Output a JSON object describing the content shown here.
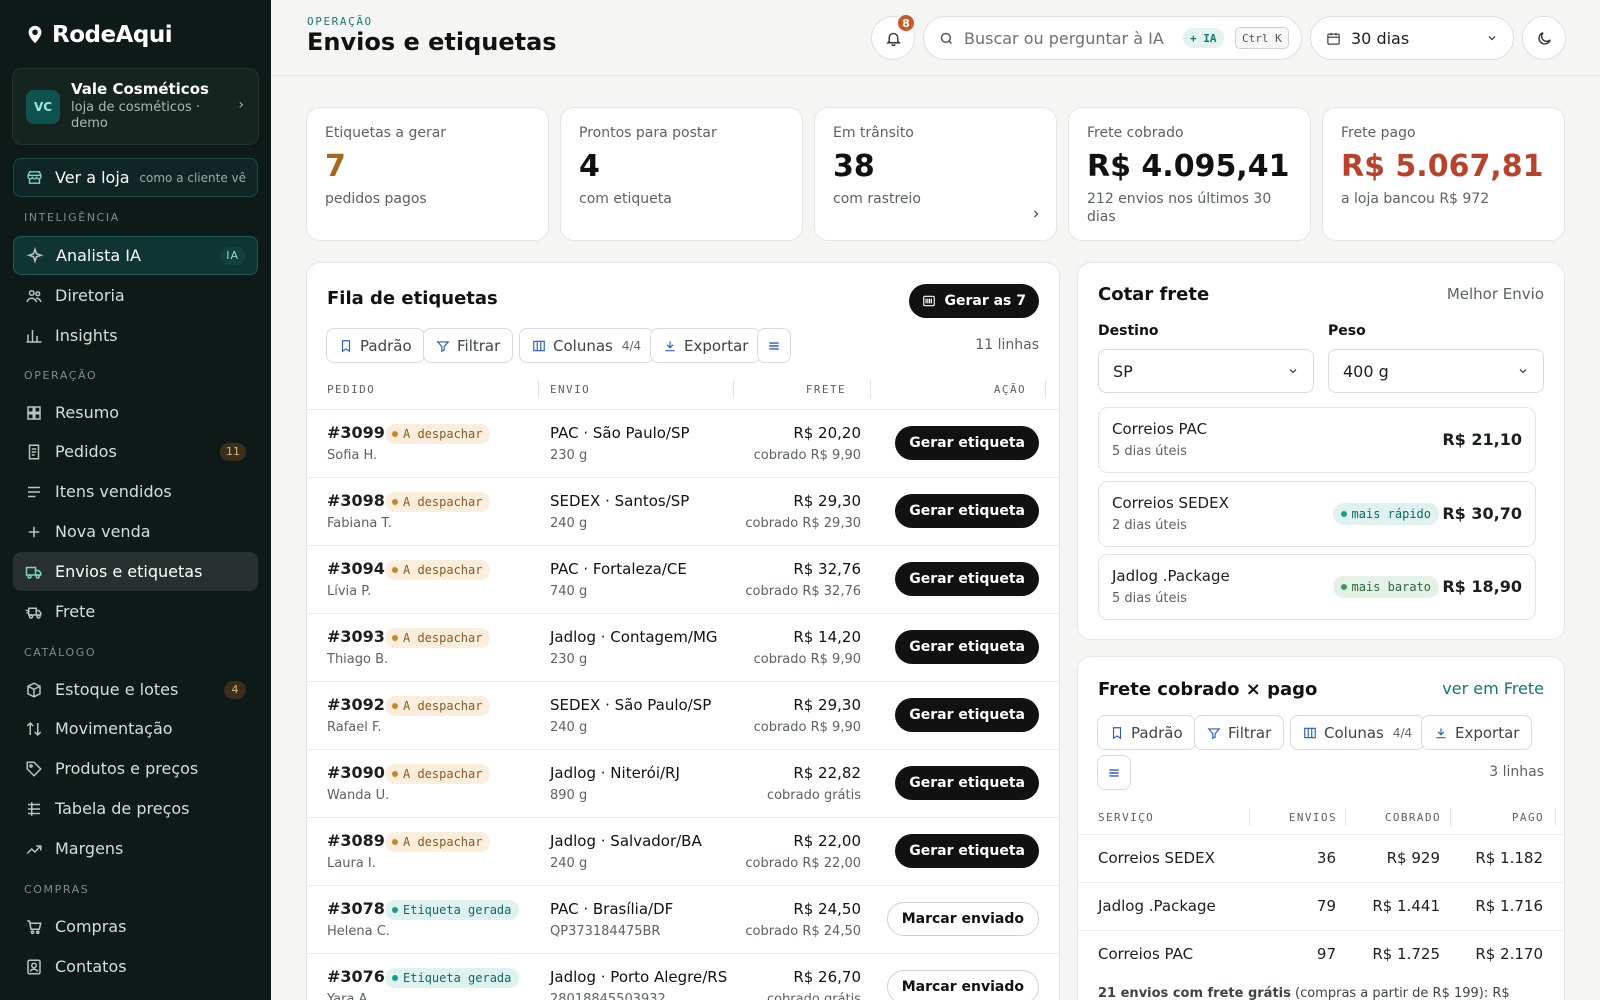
{
  "brand": {
    "name": "RodeAqui"
  },
  "store": {
    "initials": "VC",
    "name": "Vale Cosméticos",
    "subtitle": "loja de cosméticos · demo"
  },
  "view_store": {
    "label": "Ver a loja",
    "hint": "como a cliente vê"
  },
  "sidebar": {
    "sections": {
      "intel": "INTELIGÊNCIA",
      "op": "OPERAÇÃO",
      "cat": "CATÁLOGO",
      "compras": "COMPRAS"
    },
    "items": [
      {
        "label": "Analista IA",
        "badge": "IA",
        "icon": "sparkle-icon"
      },
      {
        "label": "Diretoria",
        "icon": "users-icon"
      },
      {
        "label": "Insights",
        "icon": "bar-chart-icon"
      },
      {
        "label": "Resumo",
        "icon": "grid-icon"
      },
      {
        "label": "Pedidos",
        "badge": "11",
        "icon": "receipt-icon"
      },
      {
        "label": "Itens vendidos",
        "icon": "list-icon"
      },
      {
        "label": "Nova venda",
        "icon": "plus-icon"
      },
      {
        "label": "Envios e etiquetas",
        "icon": "truck-icon"
      },
      {
        "label": "Frete",
        "icon": "truck-fast-icon"
      },
      {
        "label": "Estoque e lotes",
        "badge": "4",
        "icon": "box-icon"
      },
      {
        "label": "Movimentação",
        "icon": "arrows-updown-icon"
      },
      {
        "label": "Produtos e preços",
        "icon": "tag-icon"
      },
      {
        "label": "Tabela de preços",
        "icon": "table-icon"
      },
      {
        "label": "Margens",
        "icon": "trend-icon"
      },
      {
        "label": "Compras",
        "icon": "cart-icon"
      },
      {
        "label": "Contatos",
        "icon": "contact-icon"
      }
    ]
  },
  "header": {
    "eyebrow": "OPERAÇÃO",
    "title": "Envios e etiquetas",
    "notifications": "8",
    "search_placeholder": "Buscar ou perguntar à IA",
    "search_ai_tag": "+ IA",
    "search_shortcut": "Ctrl K",
    "period": "30 dias"
  },
  "kpis": [
    {
      "label": "Etiquetas a gerar",
      "value": "7",
      "sub": "pedidos pagos",
      "color": "#a86a1a"
    },
    {
      "label": "Prontos para postar",
      "value": "4",
      "sub": "com etiqueta",
      "color": "#111111"
    },
    {
      "label": "Em trânsito",
      "value": "38",
      "sub": "com rastreio",
      "color": "#111111"
    },
    {
      "label": "Frete cobrado",
      "value": "R$ 4.095,41",
      "sub": "212 envios nos últimos 30 dias",
      "color": "#111111"
    },
    {
      "label": "Frete pago",
      "value": "R$ 5.067,81",
      "sub": "a loja bancou R$ 972",
      "color": "#b8432a"
    }
  ],
  "queue": {
    "title": "Fila de etiquetas",
    "generate_all": "Gerar as 7",
    "toolbar": {
      "preset": "Padrão",
      "filter": "Filtrar",
      "columns": "Colunas",
      "columns_count": "4/4",
      "export": "Exportar"
    },
    "row_count": "11 linhas",
    "headers": {
      "order": "PEDIDO",
      "shipping": "ENVIO",
      "freight": "FRETE",
      "action": "AÇÃO"
    },
    "rows": [
      {
        "id": "#3099",
        "status": "A despachar",
        "kind": "desp",
        "customer": "Sofia H.",
        "service": "PAC · São Paulo/SP",
        "detail": "230 g",
        "freight": "R$ 20,20",
        "charged": "cobrado R$ 9,90",
        "action": "Gerar etiqueta"
      },
      {
        "id": "#3098",
        "status": "A despachar",
        "kind": "desp",
        "customer": "Fabiana T.",
        "service": "SEDEX · Santos/SP",
        "detail": "240 g",
        "freight": "R$ 29,30",
        "charged": "cobrado R$ 29,30",
        "action": "Gerar etiqueta"
      },
      {
        "id": "#3094",
        "status": "A despachar",
        "kind": "desp",
        "customer": "Lívia P.",
        "service": "PAC · Fortaleza/CE",
        "detail": "740 g",
        "freight": "R$ 32,76",
        "charged": "cobrado R$ 32,76",
        "action": "Gerar etiqueta"
      },
      {
        "id": "#3093",
        "status": "A despachar",
        "kind": "desp",
        "customer": "Thiago B.",
        "service": "Jadlog · Contagem/MG",
        "detail": "230 g",
        "freight": "R$ 14,20",
        "charged": "cobrado R$ 9,90",
        "action": "Gerar etiqueta"
      },
      {
        "id": "#3092",
        "status": "A despachar",
        "kind": "desp",
        "customer": "Rafael F.",
        "service": "SEDEX · São Paulo/SP",
        "detail": "240 g",
        "freight": "R$ 29,30",
        "charged": "cobrado R$ 9,90",
        "action": "Gerar etiqueta"
      },
      {
        "id": "#3090",
        "status": "A despachar",
        "kind": "desp",
        "customer": "Wanda U.",
        "service": "Jadlog · Niterói/RJ",
        "detail": "890 g",
        "freight": "R$ 22,82",
        "charged": "cobrado grátis",
        "action": "Gerar etiqueta"
      },
      {
        "id": "#3089",
        "status": "A despachar",
        "kind": "desp",
        "customer": "Laura I.",
        "service": "Jadlog · Salvador/BA",
        "detail": "240 g",
        "freight": "R$ 22,00",
        "charged": "cobrado R$ 22,00",
        "action": "Gerar etiqueta"
      },
      {
        "id": "#3078",
        "status": "Etiqueta gerada",
        "kind": "ger",
        "customer": "Helena C.",
        "service": "PAC · Brasília/DF",
        "detail": "QP373184475BR",
        "freight": "R$ 24,50",
        "charged": "cobrado R$ 24,50",
        "action": "Marcar enviado"
      },
      {
        "id": "#3076",
        "status": "Etiqueta gerada",
        "kind": "ger",
        "customer": "Yara A.",
        "service": "Jadlog · Porto Alegre/RS",
        "detail": "28018845503932",
        "freight": "R$ 26,70",
        "charged": "cobrado grátis",
        "action": "Marcar enviado"
      }
    ]
  },
  "quote": {
    "title": "Cotar frete",
    "provider": "Melhor Envio",
    "dest_label": "Destino",
    "dest_value": "SP",
    "weight_label": "Peso",
    "weight_value": "400 g",
    "options": [
      {
        "name": "Correios PAC",
        "days": "5 dias úteis",
        "price": "R$ 21,10",
        "tag": ""
      },
      {
        "name": "Correios SEDEX",
        "days": "2 dias úteis",
        "price": "R$ 30,70",
        "tag": "mais rápido",
        "kind": "fast"
      },
      {
        "name": "Jadlog .Package",
        "days": "5 dias úteis",
        "price": "R$ 18,90",
        "tag": "mais barato",
        "kind": "cheap"
      }
    ]
  },
  "freight": {
    "title": "Frete cobrado × pago",
    "link": "ver em Frete",
    "row_count": "3 linhas",
    "headers": {
      "service": "SERVIÇO",
      "shipments": "ENVIOS",
      "charged": "COBRADO",
      "paid": "PAGO"
    },
    "rows": [
      {
        "service": "Correios SEDEX",
        "shipments": "36",
        "charged": "R$ 929",
        "paid": "R$ 1.182"
      },
      {
        "service": "Jadlog .Package",
        "shipments": "79",
        "charged": "R$ 1.441",
        "paid": "R$ 1.716"
      },
      {
        "service": "Correios PAC",
        "shipments": "97",
        "charged": "R$ 1.725",
        "paid": "R$ 2.170"
      }
    ],
    "footnote_bold": "21 envios com frete grátis",
    "footnote_rest": " (compras a partir de R$ 199): R$"
  }
}
